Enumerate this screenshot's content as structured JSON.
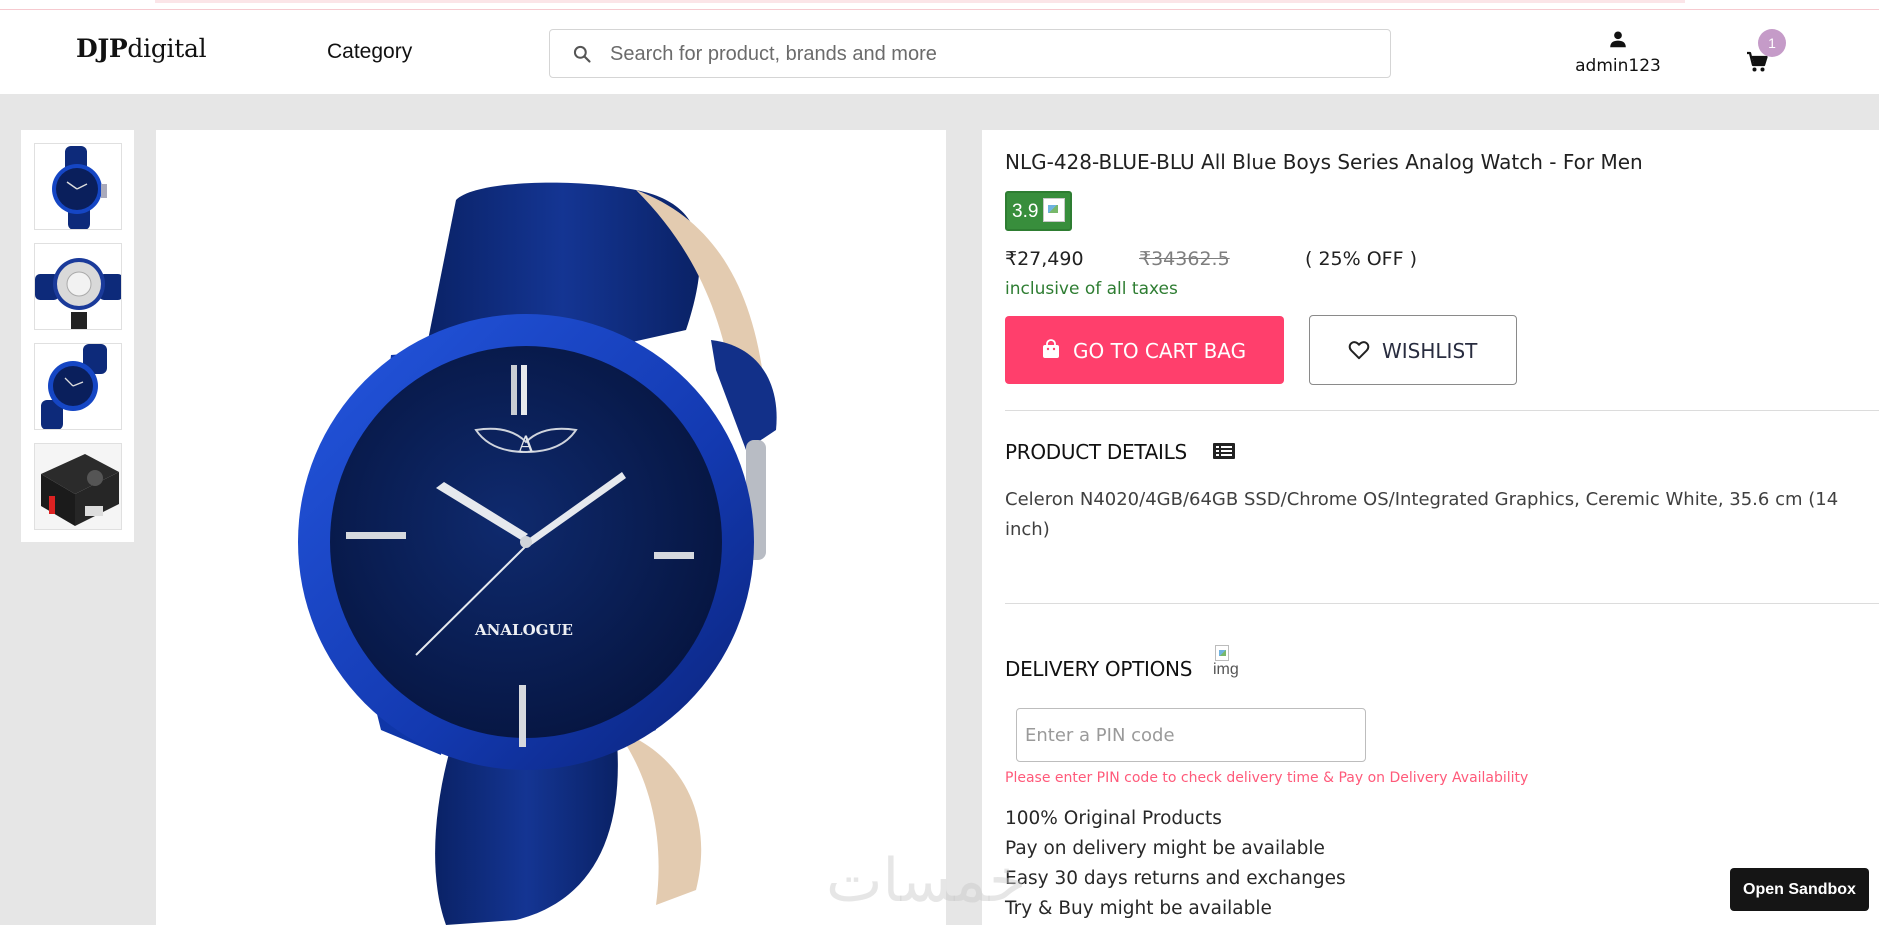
{
  "header": {
    "logo_bold": "DJP",
    "logo_rest": "digital",
    "category_label": "Category",
    "search_placeholder": "Search for product, brands and more",
    "username": "admin123",
    "cart_count": "1"
  },
  "product": {
    "title": "NLG-428-BLUE-BLU All Blue Boys Series Analog Watch - For Men",
    "rating": "3.9",
    "price": "₹27,490",
    "mrp": "₹34362.5",
    "discount": "( 25% OFF )",
    "tax_note": "inclusive of all taxes",
    "cart_button_label": "GO TO CART BAG",
    "wishlist_button_label": "WISHLIST",
    "details_heading": "PRODUCT DETAILS",
    "details_text": "Celeron N4020/4GB/64GB SSD/Chrome OS/Integrated Graphics, Ceremic White, 35.6 cm (14 inch)",
    "delivery_heading": "DELIVERY OPTIONS",
    "delivery_img_alt": "img",
    "pin_placeholder": "Enter a PIN code",
    "pin_hint": "Please enter PIN code to check delivery time & Pay on Delivery Availability",
    "features": [
      "100% Original Products",
      "Pay on delivery might be available",
      "Easy 30 days returns and exchanges",
      "Try & Buy might be available"
    ],
    "watch_dial_text": "ANALOGUE"
  },
  "sandbox_label": "Open Sandbox",
  "watermark_text": "خمسات",
  "colors": {
    "accent": "#ff3f6c",
    "rating_bg": "#388e3c",
    "tax_green": "#2e7d32",
    "watch_blue": "#0d2a7a"
  },
  "icons": [
    "search-icon",
    "user-icon",
    "cart-icon",
    "bag-icon",
    "heart-icon",
    "list-icon"
  ]
}
